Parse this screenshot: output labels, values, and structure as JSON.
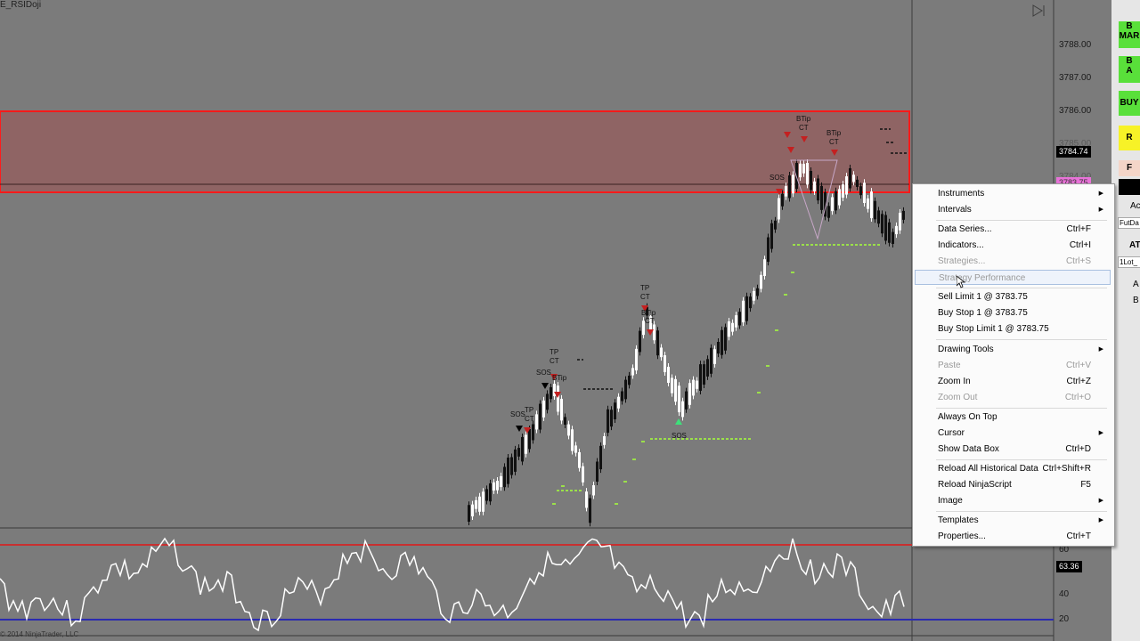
{
  "chart": {
    "title_fragment": "E_RSIDoji",
    "copyright": "© 2014 NinjaTrader, LLC",
    "price_axis": [
      "3788.00",
      "3787.00",
      "3786.00",
      "3785.00",
      "3784.00"
    ],
    "last_price": "3784.74",
    "limit_price": "3783.75",
    "indicator_value": "63.36",
    "indicator_axis": [
      "60",
      "40",
      "20"
    ],
    "annotations": {
      "sos_labels": [
        "SOS",
        "SOS",
        "SOS",
        "SOS"
      ],
      "tp_labels": [
        "TP",
        "TP",
        "TP"
      ],
      "ct_labels": [
        "CT",
        "CT",
        "CT",
        "CT",
        "CT",
        "CT"
      ],
      "btip_labels": [
        "BTip",
        "BTip",
        "BTip",
        "BTip"
      ]
    },
    "colors": {
      "background": "#7b7b7b",
      "zone_fill": "#8f6464",
      "zone_border": "#ff1a1a",
      "support_line": "#9be04a",
      "rsi_line": "#ffffff",
      "rsi_upper": "#c83030",
      "rsi_lower": "#2a2ab0",
      "last_price_bg": "#000000",
      "limit_price_bg": "#e873d8"
    }
  },
  "context_menu": {
    "items": [
      {
        "label": "Instruments",
        "shortcut": "",
        "submenu": true,
        "disabled": false
      },
      {
        "label": "Intervals",
        "shortcut": "",
        "submenu": true,
        "disabled": false
      },
      {
        "label": "Data Series...",
        "shortcut": "Ctrl+F",
        "submenu": false,
        "disabled": false
      },
      {
        "label": "Indicators...",
        "shortcut": "Ctrl+I",
        "submenu": false,
        "disabled": false
      },
      {
        "label": "Strategies...",
        "shortcut": "Ctrl+S",
        "submenu": false,
        "disabled": true
      },
      {
        "label": "Strategy Performance",
        "shortcut": "",
        "submenu": false,
        "disabled": true
      },
      {
        "label": "Sell Limit 1 @ 3783.75",
        "shortcut": "",
        "submenu": false,
        "disabled": false
      },
      {
        "label": "Buy Stop 1 @ 3783.75",
        "shortcut": "",
        "submenu": false,
        "disabled": false
      },
      {
        "label": "Buy Stop Limit 1 @ 3783.75",
        "shortcut": "",
        "submenu": false,
        "disabled": false
      },
      {
        "label": "Drawing Tools",
        "shortcut": "",
        "submenu": true,
        "disabled": false
      },
      {
        "label": "Paste",
        "shortcut": "Ctrl+V",
        "submenu": false,
        "disabled": true
      },
      {
        "label": "Zoom In",
        "shortcut": "Ctrl+Z",
        "submenu": false,
        "disabled": false
      },
      {
        "label": "Zoom Out",
        "shortcut": "Ctrl+O",
        "submenu": false,
        "disabled": true
      },
      {
        "label": "Always On Top",
        "shortcut": "",
        "submenu": false,
        "disabled": false
      },
      {
        "label": "Cursor",
        "shortcut": "",
        "submenu": true,
        "disabled": false
      },
      {
        "label": "Show Data Box",
        "shortcut": "Ctrl+D",
        "submenu": false,
        "disabled": false
      },
      {
        "label": "Reload All Historical Data",
        "shortcut": "Ctrl+Shift+R",
        "submenu": false,
        "disabled": false
      },
      {
        "label": "Reload NinjaScript",
        "shortcut": "F5",
        "submenu": false,
        "disabled": false
      },
      {
        "label": "Image",
        "shortcut": "",
        "submenu": true,
        "disabled": false
      },
      {
        "label": "Templates",
        "shortcut": "",
        "submenu": true,
        "disabled": false
      },
      {
        "label": "Properties...",
        "shortcut": "Ctrl+T",
        "submenu": false,
        "disabled": false
      }
    ]
  },
  "right_panel": {
    "buttons": [
      {
        "label": "B\nMAR",
        "color": "#59e03a"
      },
      {
        "label": "B\nA",
        "color": "#59e03a"
      },
      {
        "label": "BUY",
        "color": "#59e03a"
      },
      {
        "label": "R",
        "color": "#f7f227"
      },
      {
        "label": "F",
        "color": "#f4d5c8"
      }
    ],
    "texts": [
      "Ac",
      "FutDa",
      "AT",
      "1Lot_",
      "A",
      "B"
    ]
  }
}
